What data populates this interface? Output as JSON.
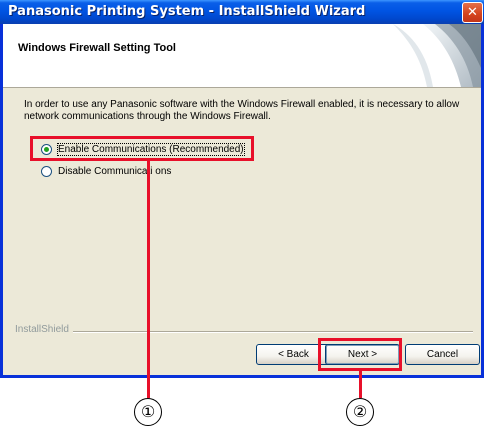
{
  "window": {
    "title": "Panasonic Printing System - InstallShield Wizard",
    "close_glyph": "✕"
  },
  "header": {
    "title": "Windows Firewall Setting Tool"
  },
  "body": {
    "description": "In order to use any Panasonic software with the Windows Firewall enabled, it is necessary to allow network communications through the Windows Firewall."
  },
  "options": [
    {
      "label": "Enable Communications (Recommended)",
      "checked": true
    },
    {
      "label": "Disable Communicati ons",
      "checked": false
    }
  ],
  "footer": {
    "brand": "InstallShield"
  },
  "buttons": {
    "back": "< Back",
    "next": "Next >",
    "cancel": "Cancel"
  },
  "callouts": {
    "one": "①",
    "two": "②"
  },
  "colors": {
    "titlebar": "#0054e3",
    "dialog_bg": "#ece9d8",
    "annotation_red": "#e8102a"
  }
}
